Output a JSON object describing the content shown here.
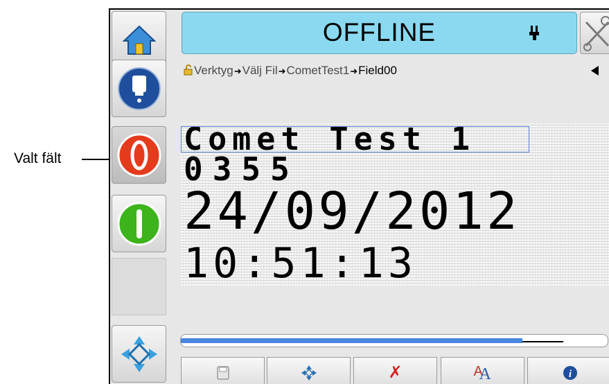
{
  "callout": {
    "label": "Valt fält"
  },
  "status": {
    "text": "OFFLINE"
  },
  "breadcrumb": {
    "items": [
      "Verktyg",
      "Välj Fil",
      "CometTest1",
      "Field00"
    ]
  },
  "message": {
    "lines": [
      "Comet Test 1",
      "0355",
      "24/09/2012",
      "10:51:13"
    ]
  },
  "progress": {
    "value": 0.8
  },
  "toolbar": {
    "icons": {
      "delete": "✗",
      "font": "A"
    }
  },
  "sidebar": {
    "buttons": [
      "home-icon",
      "ink-cartridge-icon",
      "stop-icon",
      "start-icon",
      "navigate-icon"
    ]
  },
  "colors": {
    "status_bg": "#8ad9f0",
    "stop": "#e53b1d",
    "start": "#3db31c",
    "accent_blue": "#1f4f9c",
    "progress": "#4a86e0"
  }
}
